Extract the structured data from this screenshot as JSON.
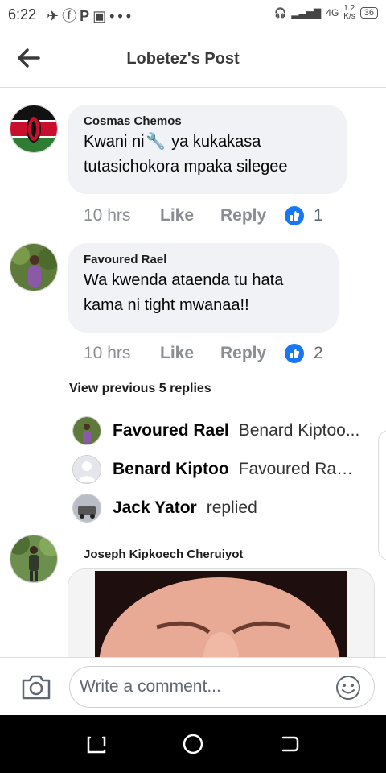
{
  "status": {
    "time": "6:22",
    "speed": "1.2\nK/s",
    "network": "4G",
    "battery": "36"
  },
  "header": {
    "title": "Lobetez's Post"
  },
  "comments": [
    {
      "author": "Cosmas Chemos",
      "text_before": "Kwani ni",
      "text_after": " ya kukakasa tutasichokora mpaka silegee",
      "time": "10 hrs",
      "like": "Like",
      "reply": "Reply",
      "likes": "1"
    },
    {
      "author": "Favoured Rael",
      "text": "Wa kwenda ataenda tu hata kama ni tight mwanaa!!",
      "time": "10 hrs",
      "like": "Like",
      "reply": "Reply",
      "likes": "2"
    }
  ],
  "thread": {
    "view_previous": "View previous 5 replies",
    "replies": [
      {
        "name": "Favoured Rael",
        "text": "Benard Kiptoo..."
      },
      {
        "name": "Benard Kiptoo",
        "text": "Favoured Rael..."
      },
      {
        "name": "Jack Yator",
        "text": "replied"
      }
    ]
  },
  "comment3": {
    "author": "Joseph Kipkoech Cheruiyot"
  },
  "composer": {
    "placeholder": "Write a comment..."
  },
  "colors": {
    "accent": "#1877f2",
    "bubble": "#f0f2f5",
    "meta": "#8a8d91"
  }
}
